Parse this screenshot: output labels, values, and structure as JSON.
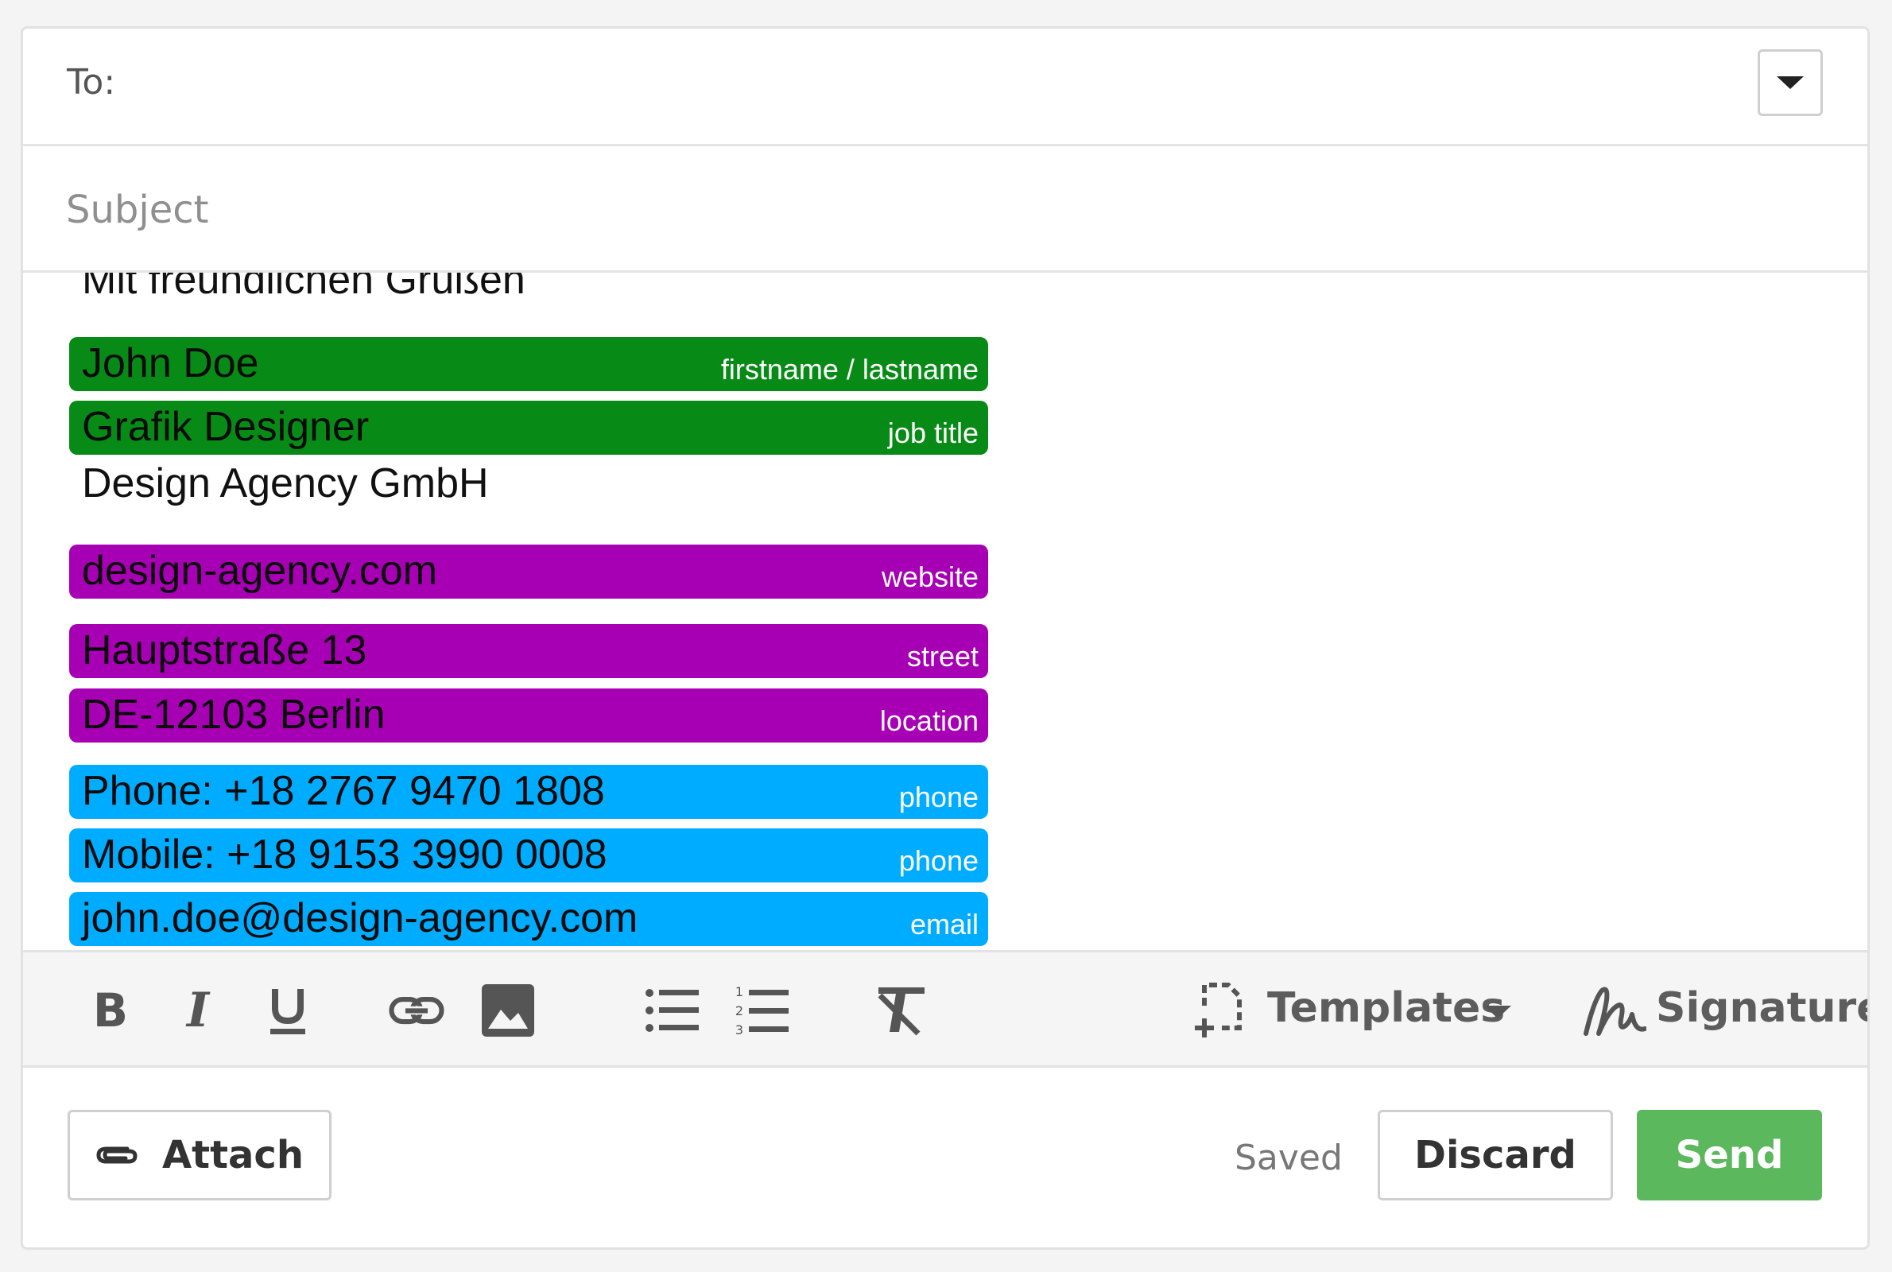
{
  "header": {
    "to_label": "To:",
    "dropdown_icon": "caret-down-icon"
  },
  "subject": {
    "placeholder": "Subject",
    "value": ""
  },
  "body": {
    "greeting": "Mit freundlichen Grüßen",
    "company": "Design Agency GmbH",
    "signature": {
      "name": {
        "value": "John Doe",
        "tag": "firstname / lastname",
        "color": "#078b16"
      },
      "title": {
        "value": "Grafik Designer",
        "tag": "job title",
        "color": "#078b16"
      },
      "website": {
        "value": "design-agency.com",
        "tag": "website",
        "color": "#a700b4"
      },
      "street": {
        "value": "Hauptstraße 13",
        "tag": "street",
        "color": "#a700b4"
      },
      "location": {
        "value": "DE-12103 Berlin",
        "tag": "location",
        "color": "#a700b4"
      },
      "phone": {
        "value": "Phone: +18 2767 9470 1808",
        "tag": "phone",
        "color": "#00acff"
      },
      "mobile": {
        "value": "Mobile: +18 9153 3990 0008",
        "tag": "phone",
        "color": "#00acff"
      },
      "email": {
        "value": "john.doe@design-agency.com",
        "tag": "email",
        "color": "#00acff"
      }
    }
  },
  "toolbar": {
    "icons": [
      "bold-icon",
      "italic-icon",
      "underline-icon",
      "link-icon",
      "image-icon",
      "bulleted-list-icon",
      "numbered-list-icon",
      "clear-format-icon",
      "templates-icon",
      "signature-icon"
    ],
    "templates_label": "Templates",
    "signature_label": "Signature"
  },
  "footer": {
    "attach_label": "Attach",
    "saved_status": "Saved",
    "discard_label": "Discard",
    "send_label": "Send",
    "send_color": "#5cb85c"
  }
}
